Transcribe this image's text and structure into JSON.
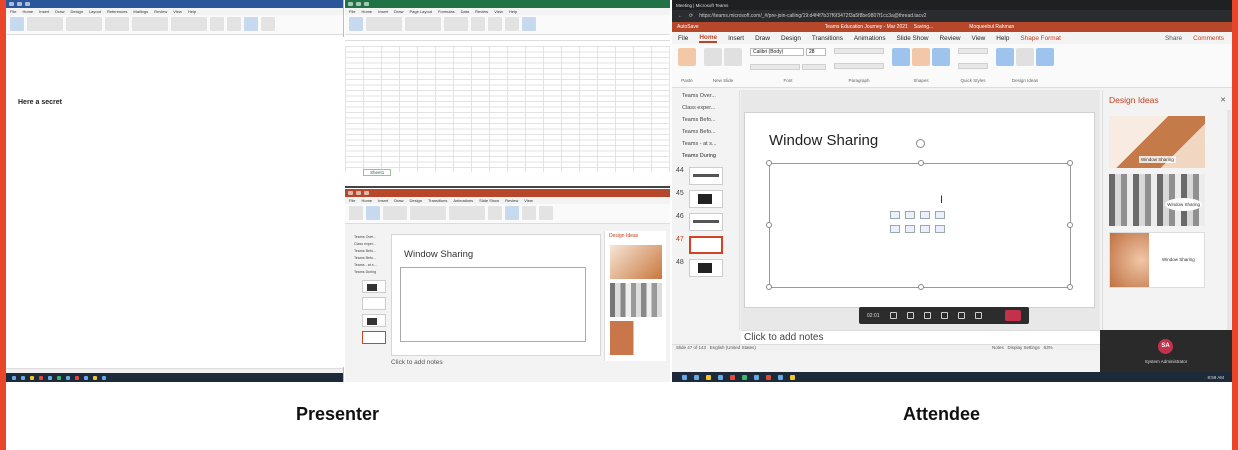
{
  "captions": {
    "presenter": "Presenter",
    "attendee": "Attendee"
  },
  "presenter": {
    "word": {
      "body_text": "Here a secret"
    },
    "excel": {
      "sheet_tab": "Sheet1"
    },
    "ppt": {
      "slide_title": "Window Sharing",
      "notes_placeholder": "Click to add notes",
      "design_ideas": "Design Ideas"
    }
  },
  "attendee": {
    "browser": {
      "tab_title": "Meeting | Microsoft Teams",
      "url": "https://teams.microsoft.com/_#/pre-join-calling/19:d4f4f7b37f6f3472f3a5f8be9807f1cc3a@thread.tacv2"
    },
    "ppt": {
      "autosave": "AutoSave",
      "doc_title": "Teams Education Journey - Mar 2021",
      "saving": "Saving...",
      "user": "Moqueebul Rahman",
      "menu": [
        "File",
        "Home",
        "Insert",
        "Draw",
        "Design",
        "Transitions",
        "Animations",
        "Slide Show",
        "Review",
        "View",
        "Help",
        "Shape Format"
      ],
      "active_menu": "Home",
      "share": "Share",
      "comments": "Comments",
      "font_name": "Calibri (Body)",
      "font_size": "28",
      "ribbon_labels": [
        "Paste",
        "New Slide",
        "Reuse Slides",
        "Font",
        "Paragraph",
        "Shapes",
        "Arrange",
        "Quick Styles",
        "Find",
        "Replace",
        "Select",
        "Dictate",
        "Sensitivity",
        "Design Ideas"
      ],
      "sections": [
        "Teams Over...",
        "Class exper...",
        "Teams Befo...",
        "Teams Befo...",
        "Teams - at s...",
        "Teams During"
      ],
      "slide_numbers": [
        "44",
        "45",
        "46",
        "47",
        "48"
      ],
      "selected_slide": "47",
      "slide_title": "Window Sharing",
      "notes_placeholder": "Click to add notes",
      "design_ideas_title": "Design Ideas",
      "design_captions": [
        "Window Sharing",
        "Window Sharing",
        "Window Sharing"
      ],
      "status_left": "Slide 47 of 143",
      "status_lang": "English (United States)",
      "status_notes": "Notes",
      "status_display": "Display Settings",
      "status_zoom": "63%"
    },
    "meeting": {
      "timer": "02:01"
    },
    "presence": {
      "initials": "SA",
      "name": "System Administrator"
    },
    "taskbar_time": "8:59 AM"
  }
}
